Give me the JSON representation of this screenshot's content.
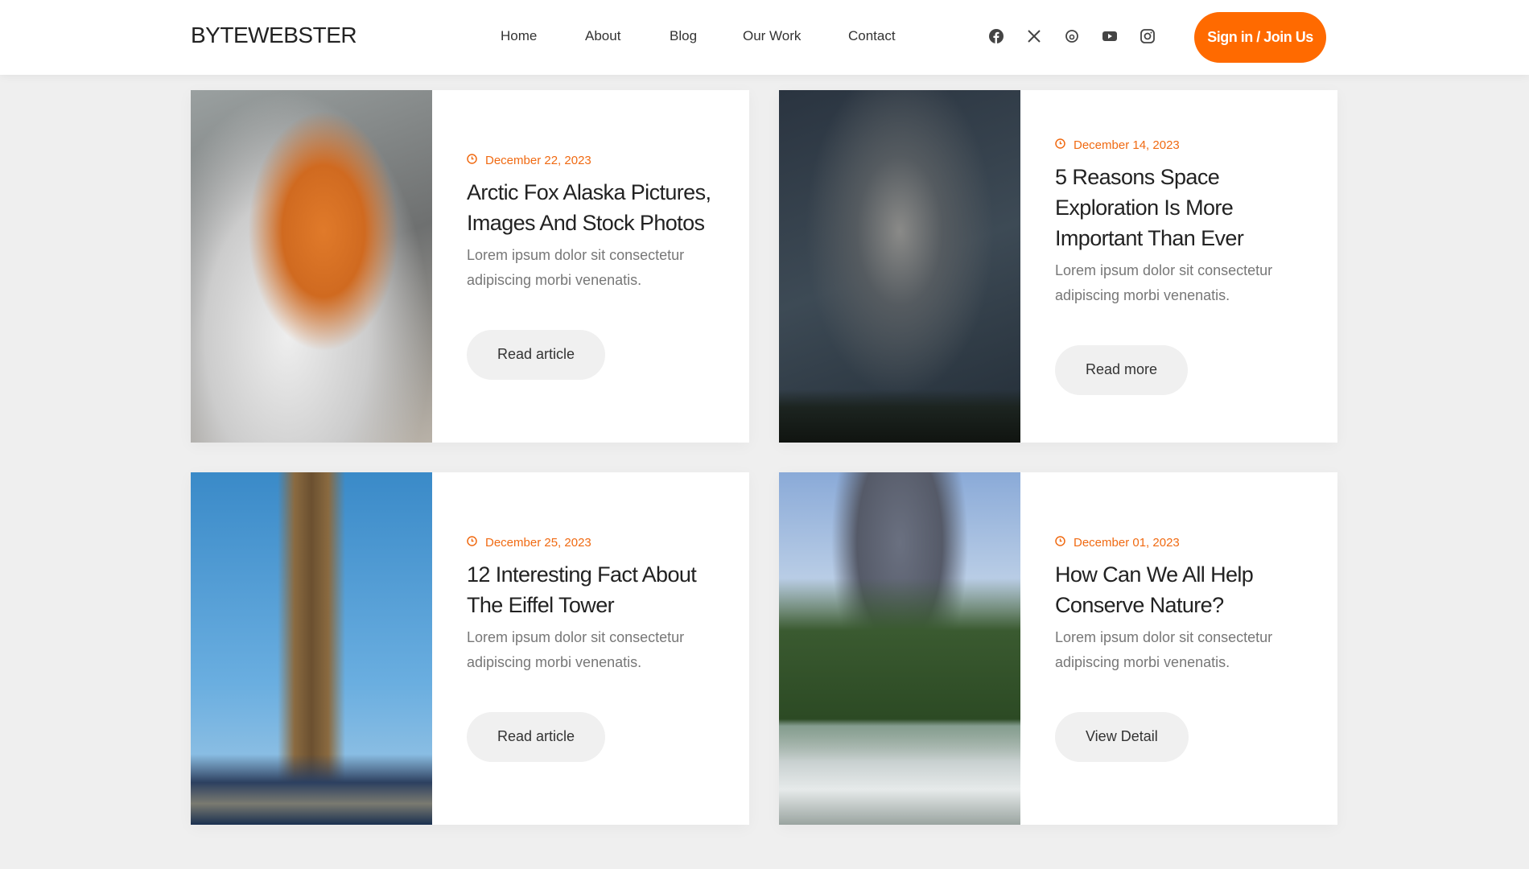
{
  "header": {
    "logo": "BYTEWEBSTER",
    "nav": [
      "Home",
      "About",
      "Blog",
      "Our Work",
      "Contact"
    ],
    "social_icons": [
      "facebook-icon",
      "x-icon",
      "threads-icon",
      "youtube-icon",
      "instagram-icon"
    ],
    "signin_label": "Sign in / Join Us",
    "accent": "#ff6a00"
  },
  "cards": [
    {
      "date": "December 22, 2023",
      "title": "Arctic Fox Alaska Pictures, Images And Stock Photos",
      "desc": "Lorem ipsum dolor sit consectetur adipiscing morbi venenatis.",
      "button": "Read article",
      "image": "fox"
    },
    {
      "date": "December 14, 2023",
      "title": "5 Reasons Space Exploration Is More Important Than Ever",
      "desc": "Lorem ipsum dolor sit consectetur adipiscing morbi venenatis.",
      "button": "Read more",
      "image": "milky-way"
    },
    {
      "date": "December 25, 2023",
      "title": "12 Interesting Fact About The Eiffel Tower",
      "desc": "Lorem ipsum dolor sit consectetur adipiscing morbi venenatis.",
      "button": "Read article",
      "image": "eiffel-tower"
    },
    {
      "date": "December 01, 2023",
      "title": "How Can We All Help Conserve Nature?",
      "desc": "Lorem ipsum dolor sit consectetur adipiscing morbi venenatis.",
      "button": "View Detail",
      "image": "mountain-river"
    }
  ]
}
